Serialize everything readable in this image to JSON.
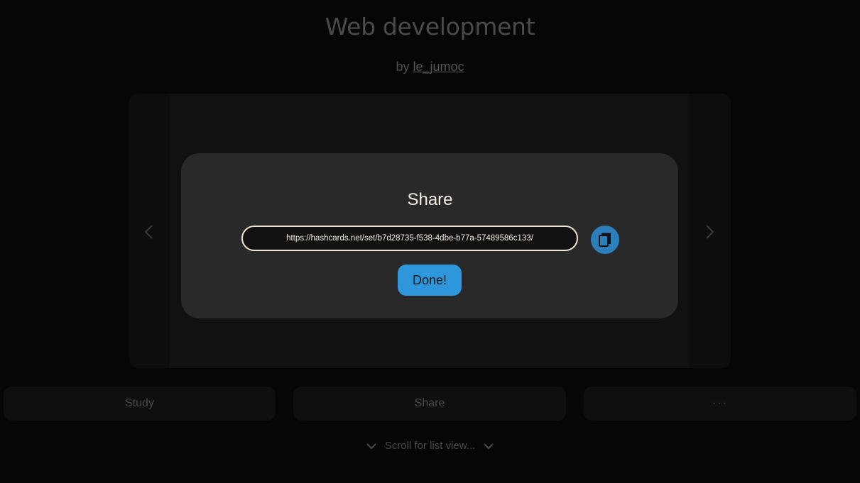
{
  "header": {
    "title": "Web development",
    "by_prefix": "by",
    "author": "le_jumoc"
  },
  "card_viewer": {
    "prev_icon": "chevron-left-icon",
    "next_icon": "chevron-right-icon"
  },
  "actions": {
    "study_label": "Study",
    "share_label": "Share",
    "more_label": "···"
  },
  "scroll_hint": {
    "label": "Scroll for list view...",
    "icon": "chevron-down-icon"
  },
  "share_modal": {
    "title": "Share",
    "url": "https://hashcards.net/set/b7d28735-f538-4dbe-b77a-57489586c133/",
    "copy_icon": "copy-icon",
    "done_label": "Done!"
  },
  "colors": {
    "background": "#060606",
    "modal_bg": "#292929",
    "accent": "#2e97dc",
    "copy_button": "#2d7fb9"
  }
}
